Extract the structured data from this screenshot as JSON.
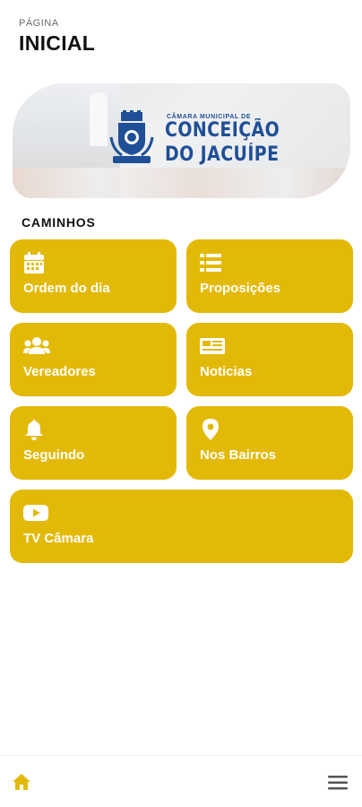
{
  "header": {
    "subtitle": "PÁGINA",
    "title": "INICIAL"
  },
  "banner": {
    "logo_line1": "CÂMARA MUNICIPAL DE",
    "logo_line2": "CONCEIÇÃO",
    "logo_line3": "DO JACUÍPE",
    "brand_color": "#1f4f96"
  },
  "section_title": "CAMINHOS",
  "accent_color": "#e3b908",
  "tiles": [
    {
      "label": "Ordem do dia",
      "icon": "calendar-icon"
    },
    {
      "label": "Proposições",
      "icon": "list-icon"
    },
    {
      "label": "Vereadores",
      "icon": "users-icon"
    },
    {
      "label": "Noticias",
      "icon": "newspaper-icon"
    },
    {
      "label": "Seguindo",
      "icon": "bell-icon"
    },
    {
      "label": "Nos Bairros",
      "icon": "map-pin-icon"
    },
    {
      "label": "TV Câmara",
      "icon": "youtube-icon"
    }
  ],
  "bottom_nav": {
    "left_icon": "home-icon",
    "right_icon": "hamburger-menu-icon"
  }
}
